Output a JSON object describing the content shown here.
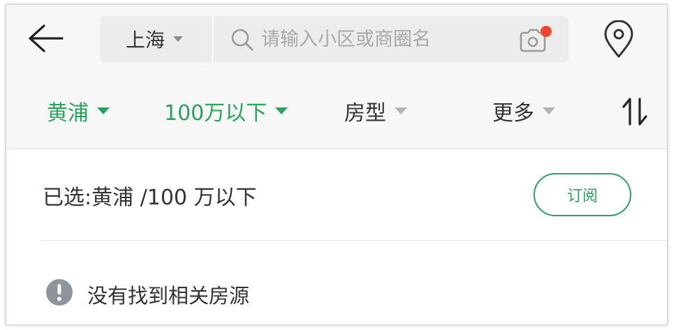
{
  "header": {
    "back_icon": "arrow-left-icon",
    "city": "上海",
    "search": {
      "placeholder": "请输入小区或商圈名",
      "value": ""
    },
    "camera_icon": "camera-icon",
    "location_icon": "map-pin-icon"
  },
  "filters": {
    "items": [
      {
        "label": "黄浦",
        "active": true
      },
      {
        "label": "100万以下",
        "active": true
      },
      {
        "label": "房型",
        "active": false
      },
      {
        "label": "更多",
        "active": false
      }
    ],
    "sort_icon": "sort-arrows-icon"
  },
  "selection": {
    "text": "已选:黄浦 /100 万以下",
    "subscribe_label": "订阅"
  },
  "empty_state": {
    "icon": "exclamation-circle-icon",
    "message": "没有找到相关房源"
  },
  "colors": {
    "accent": "#2aa35d",
    "notification_dot": "#f1472f",
    "header_bg": "#f7f7f7",
    "search_bg": "#ececec"
  }
}
